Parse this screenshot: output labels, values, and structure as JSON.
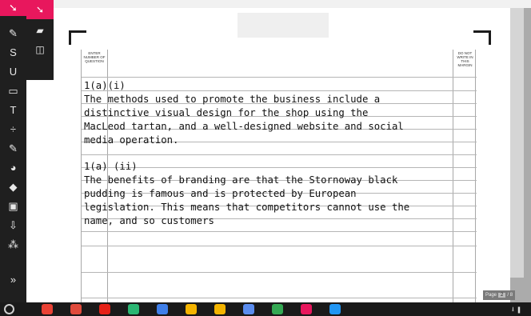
{
  "toolbar": {
    "tools": [
      {
        "icon": "select-arrow-icon",
        "glyph": "➘"
      },
      {
        "icon": "highlighter-icon",
        "glyph": "✎"
      },
      {
        "icon": "strikethrough-icon",
        "glyph": "S"
      },
      {
        "icon": "underline-icon",
        "glyph": "U"
      },
      {
        "icon": "comment-icon",
        "glyph": "▭"
      },
      {
        "icon": "text-icon",
        "glyph": "T"
      },
      {
        "icon": "divide-icon",
        "glyph": "÷"
      },
      {
        "icon": "pen-icon",
        "glyph": "✎"
      },
      {
        "icon": "voice-comment-icon",
        "glyph": "◕"
      },
      {
        "icon": "eraser-icon",
        "glyph": "◆"
      },
      {
        "icon": "image-icon",
        "glyph": "▣"
      },
      {
        "icon": "pin-icon",
        "glyph": "⇩"
      },
      {
        "icon": "page-add-icon",
        "glyph": "⁂"
      },
      {
        "icon": "more-icon",
        "glyph": "»"
      }
    ],
    "flyout": [
      {
        "icon": "select-arrow-icon",
        "glyph": "➘"
      },
      {
        "icon": "note-icon",
        "glyph": "▰"
      },
      {
        "icon": "frame-icon",
        "glyph": "◫"
      }
    ]
  },
  "sheet": {
    "header_left": "ENTER NUMBER OF QUESTION",
    "header_right": "DO NOT WRITE IN THIS MARGIN",
    "lines": [
      "1(a)(i)",
      "The methods used to promote the business include a",
      "distinctive visual design for the shop using the",
      "MacLeod tartan, and a well-designed website and social",
      "media operation.",
      "",
      "1(a) (ii)",
      "The benefits of branding are that the Stornoway black",
      "pudding is famous and is protected by European",
      "legislation. This means that competitors cannot use the",
      "name, and so customers"
    ]
  },
  "page_indicator": {
    "label": "Page",
    "current": "2",
    "total": "/ 8"
  },
  "taskbar": {
    "apps": [
      {
        "icon": "chrome-icon",
        "color": "#e94235"
      },
      {
        "icon": "gmail-icon",
        "color": "#e04b3c"
      },
      {
        "icon": "youtube-icon",
        "color": "#e62117"
      },
      {
        "icon": "play-store-icon",
        "color": "#2bb673"
      },
      {
        "icon": "docs-icon",
        "color": "#3f7fe9"
      },
      {
        "icon": "keep-icon",
        "color": "#f5b400"
      },
      {
        "icon": "slides-icon",
        "color": "#f4b400"
      },
      {
        "icon": "sheets-icon",
        "color": "#5b8def"
      },
      {
        "icon": "drive-icon",
        "color": "#34a853"
      },
      {
        "icon": "kami-icon",
        "color": "#e8175d"
      },
      {
        "icon": "app-icon",
        "color": "#2196f3"
      }
    ],
    "tray": "⭳ ▮"
  },
  "colors": {
    "accent": "#e8175d",
    "toolbar_bg": "#1f1f1f",
    "taskbar_bg": "#1a1a1a"
  }
}
